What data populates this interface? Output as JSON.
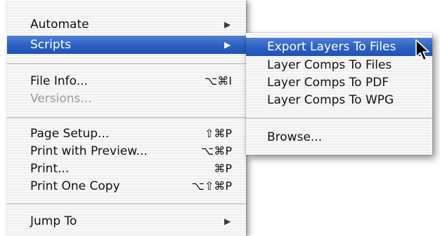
{
  "main_menu": {
    "automate": {
      "label": "Automate",
      "shortcut": "",
      "arrow": "▶"
    },
    "scripts": {
      "label": "Scripts",
      "shortcut": "",
      "arrow": "▶"
    },
    "file_info": {
      "label": "File Info...",
      "shortcut": "⌥⌘I"
    },
    "versions": {
      "label": "Versions...",
      "shortcut": ""
    },
    "page_setup": {
      "label": "Page Setup...",
      "shortcut": "⇧⌘P"
    },
    "print_with_preview": {
      "label": "Print with Preview...",
      "shortcut": "⌥⌘P"
    },
    "print": {
      "label": "Print...",
      "shortcut": "⌘P"
    },
    "print_one_copy": {
      "label": "Print One Copy",
      "shortcut": "⌥⇧⌘P"
    },
    "jump_to": {
      "label": "Jump To",
      "shortcut": "",
      "arrow": "▶"
    }
  },
  "scripts_submenu": {
    "export_layers": {
      "label": "Export Layers To Files"
    },
    "comps_to_files": {
      "label": "Layer Comps To Files"
    },
    "comps_to_pdf": {
      "label": "Layer Comps To PDF"
    },
    "comps_to_wpg": {
      "label": "Layer Comps To WPG"
    },
    "browse": {
      "label": "Browse..."
    }
  },
  "state": {
    "highlighted_main_item": "Scripts",
    "highlighted_sub_item": "Export Layers To Files",
    "disabled_items": [
      "Versions..."
    ]
  },
  "colors": {
    "highlight": "#2b60c2",
    "menu_background": "#f6f6f6",
    "disabled_text": "#9a9a9a"
  },
  "icons": {
    "submenu_arrow": "triangle-right-icon",
    "pointer": "arrow-cursor-icon"
  }
}
